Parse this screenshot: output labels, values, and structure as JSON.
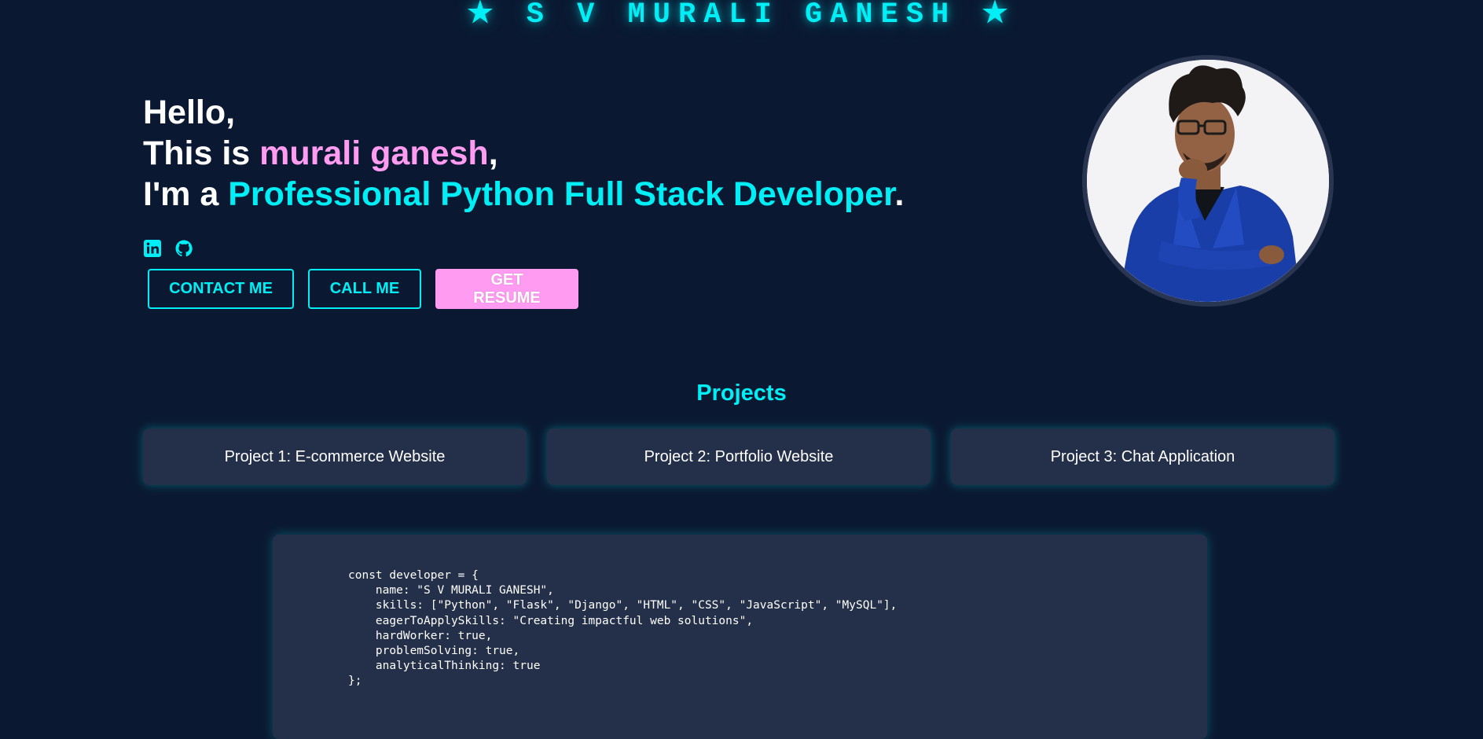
{
  "header": {
    "title": "★ S V MURALI GANESH ★"
  },
  "hero": {
    "line1": "Hello,",
    "line2_prefix": "This is ",
    "line2_name": "murali ganesh",
    "line2_suffix": ",",
    "line3_prefix": "I'm a ",
    "line3_role": "Professional Python Full Stack Developer",
    "line3_suffix": "."
  },
  "socials": {
    "items": [
      {
        "icon": "linkedin-icon"
      },
      {
        "icon": "github-icon"
      }
    ]
  },
  "buttons": {
    "contact": "CONTACT ME",
    "call": "CALL ME",
    "resume": "GET RESUME"
  },
  "projects": {
    "heading": "Projects",
    "items": [
      {
        "label": "Project 1: E-commerce Website"
      },
      {
        "label": "Project 2: Portfolio Website"
      },
      {
        "label": "Project 3: Chat Application"
      }
    ]
  },
  "code": {
    "lines": [
      "const developer = {",
      "    name: \"S V MURALI GANESH\",",
      "    skills: [\"Python\", \"Flask\", \"Django\", \"HTML\", \"CSS\", \"JavaScript\", \"MySQL\"],",
      "    eagerToApplySkills: \"Creating impactful web solutions\",",
      "    hardWorker: true,",
      "    problemSolving: true,",
      "    analyticalThinking: true",
      "};"
    ]
  },
  "colors": {
    "background": "#0a1931",
    "accent_cyan": "#00eef5",
    "accent_pink": "#ff9cf2",
    "card": "#243049"
  }
}
